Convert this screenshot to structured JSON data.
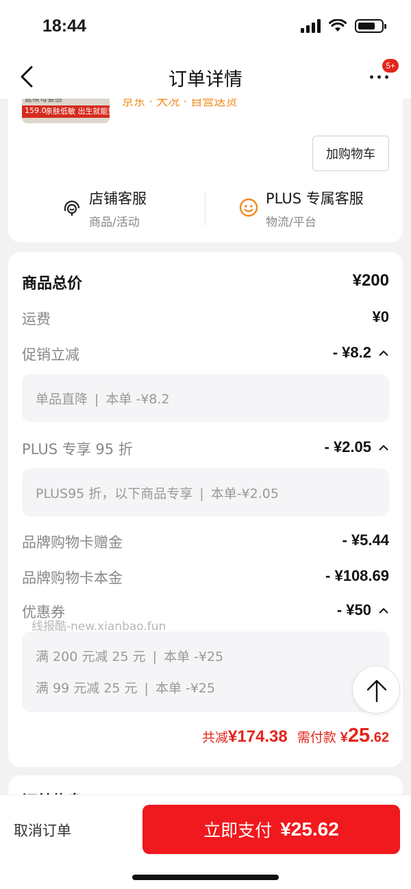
{
  "status_bar": {
    "time": "18:44"
  },
  "nav": {
    "title": "订单详情",
    "badge": "5+"
  },
  "product": {
    "thumb_banner_top": "延续母婴感",
    "thumb_price": "159.0",
    "thumb_text": "亲肤低敏 出生就能穿",
    "partial_line": "京东 · 大况 · 自营送货"
  },
  "actions": {
    "add_cart": "加购物车"
  },
  "services": [
    {
      "title": "店铺客服",
      "sub": "商品/活动"
    },
    {
      "title": "PLUS 专属客服",
      "sub": "物流/平台"
    }
  ],
  "price": {
    "total_label": "商品总价",
    "total_value": "¥200",
    "shipping_label": "运费",
    "shipping_value": "¥0",
    "promo_label": "促销立减",
    "promo_value": "- ¥8.2",
    "promo_detail_name": "单品直降",
    "promo_detail_value": "本单 -¥8.2",
    "plus_label": "PLUS 专享 95 折",
    "plus_value": "- ¥2.05",
    "plus_detail_name": "PLUS95 折，以下商品专享",
    "plus_detail_value": "本单-¥2.05",
    "card_gift_label": "品牌购物卡赠金",
    "card_gift_value": "- ¥5.44",
    "card_principal_label": "品牌购物卡本金",
    "card_principal_value": "- ¥108.69",
    "coupon_label": "优惠券",
    "coupon_value": "- ¥50",
    "coupons": [
      {
        "name": "满 200 元减 25 元",
        "value": "本单 -¥25"
      },
      {
        "name": "满 99 元减 25 元",
        "value": "本单 -¥25"
      }
    ],
    "summary_reduce_label": "共减",
    "summary_reduce_value": "¥174.38",
    "summary_need_label": "需付款",
    "summary_need_currency": "¥",
    "summary_need_int": "25",
    "summary_need_dec": ".62"
  },
  "watermark": "线报酷-new.xianbao.fun",
  "order_info": {
    "title": "订单信息"
  },
  "bottom": {
    "cancel": "取消订单",
    "pay_label": "立即支付",
    "pay_amount": "¥25.62"
  },
  "colors": {
    "accent": "#f0191e",
    "discount_text": "#e4251b",
    "orange": "#f08a1c"
  }
}
